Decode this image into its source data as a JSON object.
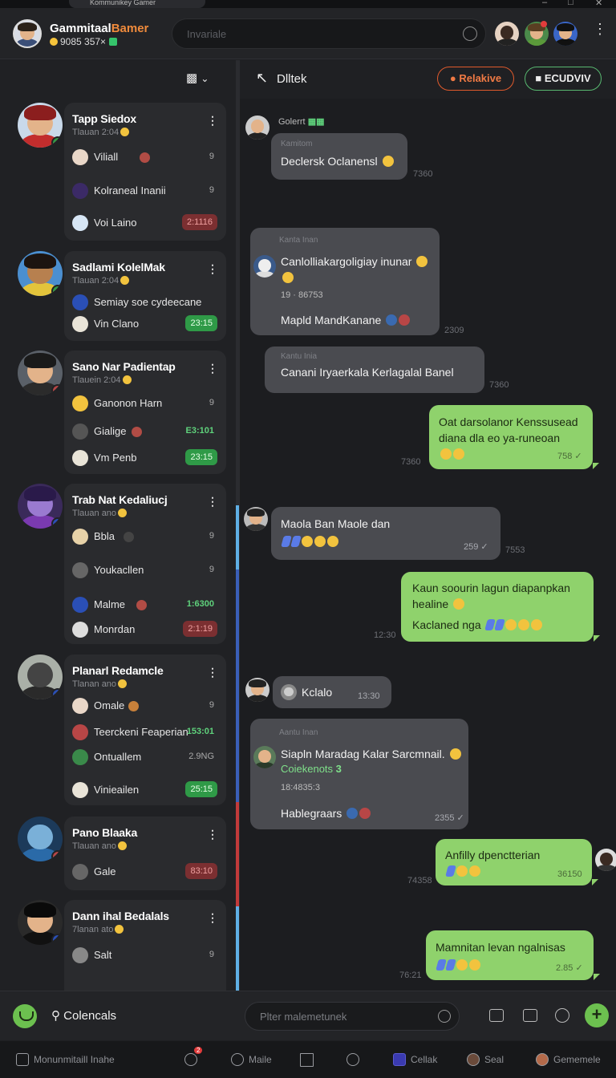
{
  "browser": {
    "tab_title": "Kommunikey Gamer"
  },
  "header": {
    "title_main": "Gammitaal",
    "title_accent": "Bamer",
    "subtitle": "9085 357×",
    "search_placeholder": "Invariale"
  },
  "sidebar": {
    "chats": [
      {
        "title": "Tapp Siedox",
        "sub": "Tlauan 2:04",
        "items": [
          {
            "label": "Viliall",
            "meta": "9"
          },
          {
            "label": "Kolraneal Inanii",
            "meta": "9"
          },
          {
            "label": "Voi Laino",
            "pill": "2:1116",
            "pill_color": "red"
          }
        ]
      },
      {
        "title": "Sadlami KolelMak",
        "sub": "Tlauan 2:04",
        "items": [
          {
            "label": "Semiay soe cydeecane"
          },
          {
            "label": "Vin Clano",
            "pill": "23:15",
            "pill_color": "green"
          }
        ]
      },
      {
        "title": "Sano Nar Padientap",
        "sub": "Tlauein 2:04",
        "items": [
          {
            "label": "Ganonon Harn",
            "meta": "9"
          },
          {
            "label": "Gialige",
            "green": "E3:101"
          },
          {
            "label": "Vm Penb",
            "pill": "23:15",
            "pill_color": "green"
          }
        ]
      },
      {
        "title": "Trab Nat Kedaliucj",
        "sub": "Tlauan ano",
        "items": [
          {
            "label": "Bbla",
            "meta": "9"
          },
          {
            "label": "Youkacllen",
            "meta": "9"
          },
          {
            "label": "Malme",
            "green": "1:6300"
          },
          {
            "label": "Monrdan",
            "pill": "2:1:19",
            "pill_color": "red"
          }
        ]
      },
      {
        "title": "Planarl Redamcle",
        "sub": "Tlanan ano",
        "items": [
          {
            "label": "Omale",
            "meta": "9"
          },
          {
            "label": "Teerckeni Feaperian",
            "green": "153:01"
          },
          {
            "label": "Ontuallem",
            "meta": "2.9NG"
          },
          {
            "label": "Vinieailen",
            "pill": "25:15",
            "pill_color": "green"
          }
        ]
      },
      {
        "title": "Pano Blaaka",
        "sub": "Tlauan ano",
        "items": [
          {
            "label": "Gale",
            "pill": "83:10",
            "pill_color": "red"
          }
        ]
      },
      {
        "title": "Dann ihal Bedalals",
        "sub": "7lanan ato",
        "items": [
          {
            "label": "Salt",
            "meta": "9"
          }
        ]
      }
    ]
  },
  "chat": {
    "name": "Dlltek",
    "btn_relative": "Relakive",
    "btn_review": "ECUDVIV",
    "messages": [
      {
        "sender": "Golerrt",
        "header": "Kamitom",
        "text": "Declersk Oclanensl",
        "ext_time": "7360"
      },
      {
        "header": "Kanta Inan",
        "text": "Canlolliakargoligiay inunar",
        "small": "19 · 86753",
        "text2": "Mapld MandKanane",
        "ext_time": "2309"
      },
      {
        "header": "Kantu Inia",
        "text": "Canani Iryaerkala Kerlagalal Banel",
        "ext_time": "7360"
      },
      {
        "text": "Oat darsolanor Kenssusead",
        "text2": "diana dla eo ya-runeoan",
        "time": "758",
        "ext_time": "7360"
      },
      {
        "text": "Maola Ban Maole dan",
        "time": "259",
        "ext_time": "7553"
      },
      {
        "text": "Kaun soourin lagun diapanpkan",
        "text2": "healine",
        "text3": "Kaclaned nga",
        "ext_time": "12:30"
      },
      {
        "text": "Kclalo",
        "time": "13:30"
      },
      {
        "header": "Aantu Inan",
        "text": "Siapln Maradag Kalar Sarcmnail.",
        "green": "Coiekenots",
        "small": "18:4835:3",
        "text2": "Hablegraars",
        "time": "2355"
      },
      {
        "text": "Anfilly dpenctterian",
        "time": "36150",
        "ext_time": "74358"
      },
      {
        "text": "Mamnitan levan ngalnisas",
        "time": "2.85",
        "ext_time": "76:21"
      }
    ]
  },
  "composer": {
    "search_label": "Colencals",
    "placeholder": "Plter malemetunek"
  },
  "bottom_nav": {
    "items": [
      "Monunmitaill Inahe",
      "Maile",
      "Cellak",
      "Seal",
      "Gememele"
    ],
    "badge": "2"
  },
  "colors": {
    "accent_orange": "#f08b3c",
    "green": "#8fd26c",
    "bubble_in": "#4a4b50"
  }
}
